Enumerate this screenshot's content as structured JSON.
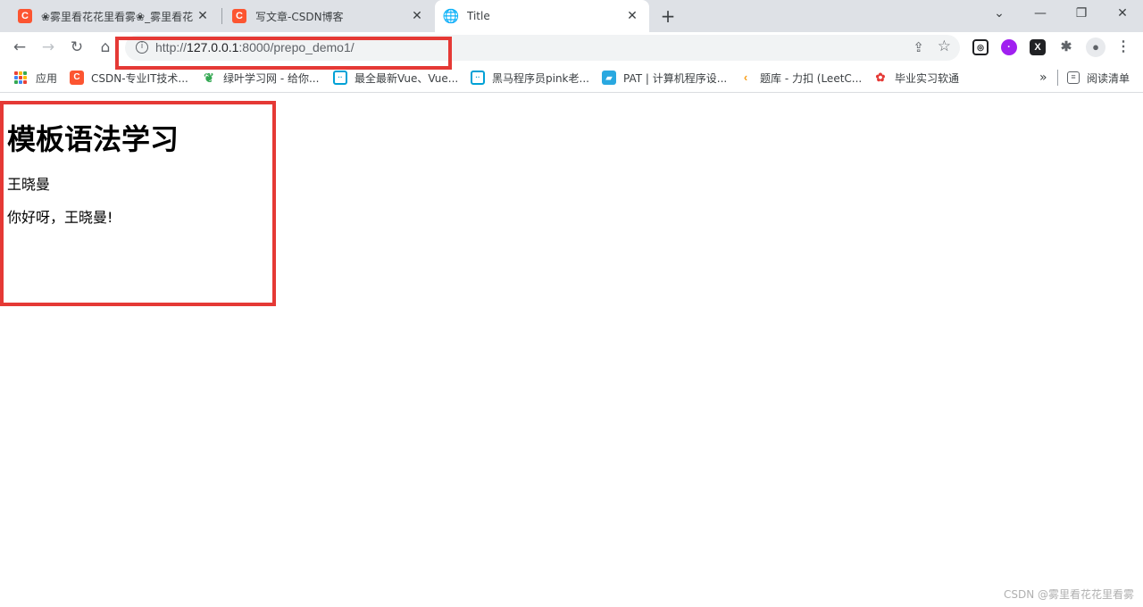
{
  "tabs": [
    {
      "title": "❀雾里看花花里看雾❀_雾里看花花里看雾",
      "favicon": "C",
      "active": false
    },
    {
      "title": "写文章-CSDN博客",
      "favicon": "C",
      "active": false
    },
    {
      "title": "Title",
      "favicon": "globe-icon",
      "active": true
    }
  ],
  "toolbar": {
    "url_scheme": "http://",
    "url_host": "127.0.0.1",
    "url_rest": ":8000/prepo_demo1/"
  },
  "bookmarks": [
    {
      "label": "应用"
    },
    {
      "label": "CSDN-专业IT技术..."
    },
    {
      "label": "绿叶学习网 - 给你..."
    },
    {
      "label": "最全最新Vue、Vue..."
    },
    {
      "label": "黑马程序员pink老..."
    },
    {
      "label": "PAT | 计算机程序设..."
    },
    {
      "label": "题库 - 力扣 (LeetC..."
    },
    {
      "label": "毕业实习软通"
    }
  ],
  "bookmarks_more": "»",
  "reading_list": "阅读清单",
  "page": {
    "heading": "模板语法学习",
    "line1": "王晓曼",
    "line2": "你好呀，王晓曼!"
  },
  "watermark": "CSDN @雾里看花花里看雾",
  "colors": {
    "accent_red_box": "#e53935",
    "csdn_brand": "#fc5531"
  }
}
